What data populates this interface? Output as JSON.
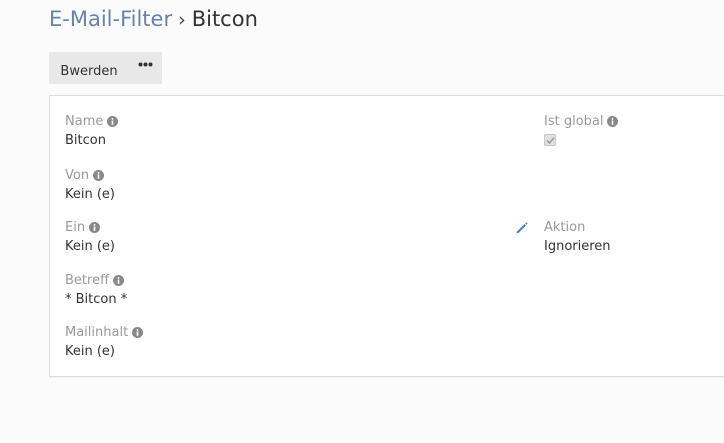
{
  "breadcrumb": {
    "parent": "E-Mail-Filter",
    "separator": "›",
    "current": "Bitcon"
  },
  "toolbar": {
    "edit_label": "Bwerden",
    "more_icon": "ellipsis-icon"
  },
  "fields": {
    "name": {
      "label": "Name",
      "value": "Bitcon"
    },
    "from": {
      "label": "Von",
      "value": "Kein (e)"
    },
    "in": {
      "label": "Ein",
      "value": "Kein (e)"
    },
    "subject": {
      "label": "Betreff",
      "value": "* Bitcon *"
    },
    "body": {
      "label": "Mailinhalt",
      "value": "Kein (e)"
    },
    "is_global": {
      "label": "Ist global",
      "checked": true
    },
    "action": {
      "label": "Aktion",
      "value": "Ignorieren"
    }
  },
  "colors": {
    "link": "#6683a8",
    "label": "#999999",
    "text": "#333333",
    "button_bg": "#e8e8e8",
    "edit_icon": "#4a7fc1"
  }
}
